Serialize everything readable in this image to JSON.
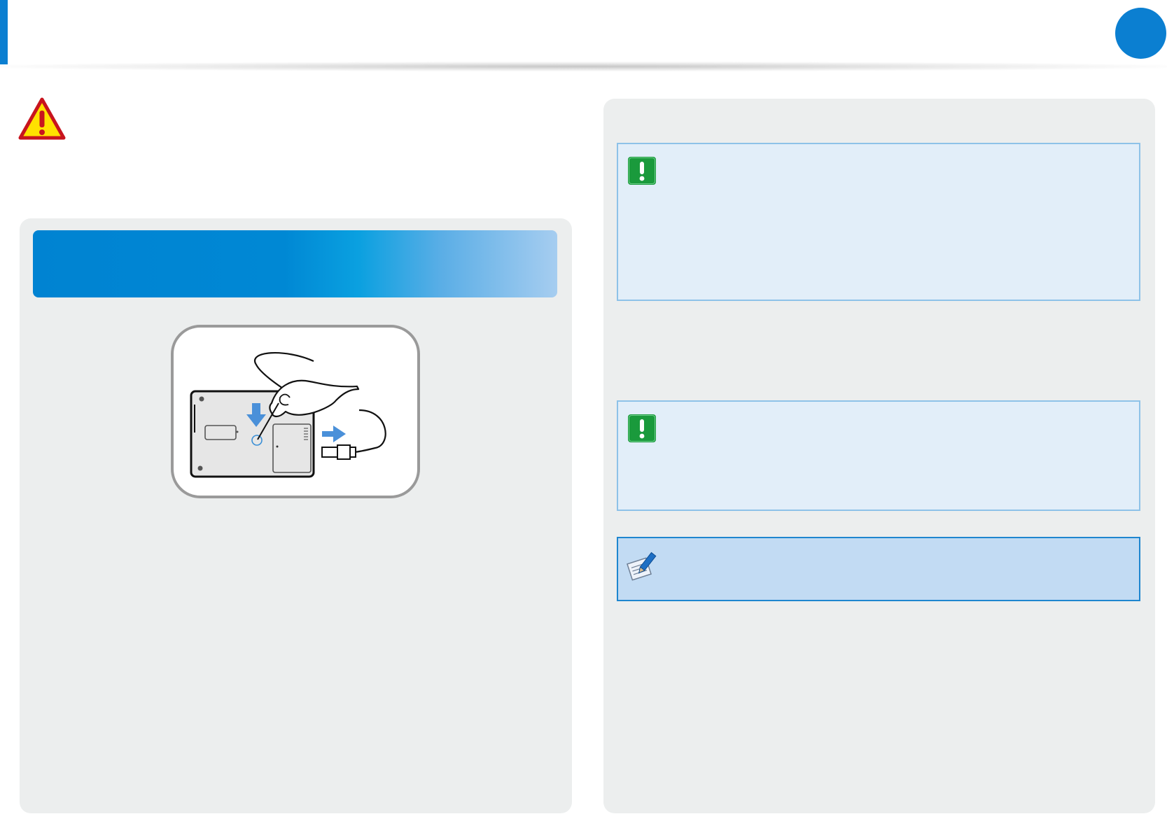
{
  "header": {
    "accent_color": "#0b7fd1",
    "page_marker_color": "#0b7fd1"
  },
  "icons": {
    "warning": "warning-triangle-icon",
    "caution": "caution-exclamation-icon",
    "note": "note-pencil-icon"
  },
  "left_panel": {
    "banner_colors": [
      "#0083d2",
      "#a6cdf0"
    ],
    "illustration": "laptop-bottom-battery-reset-illustration"
  },
  "right_panel": {
    "caution_box_color": "#e2eef9",
    "note_box_color": "#c2dbf3"
  }
}
